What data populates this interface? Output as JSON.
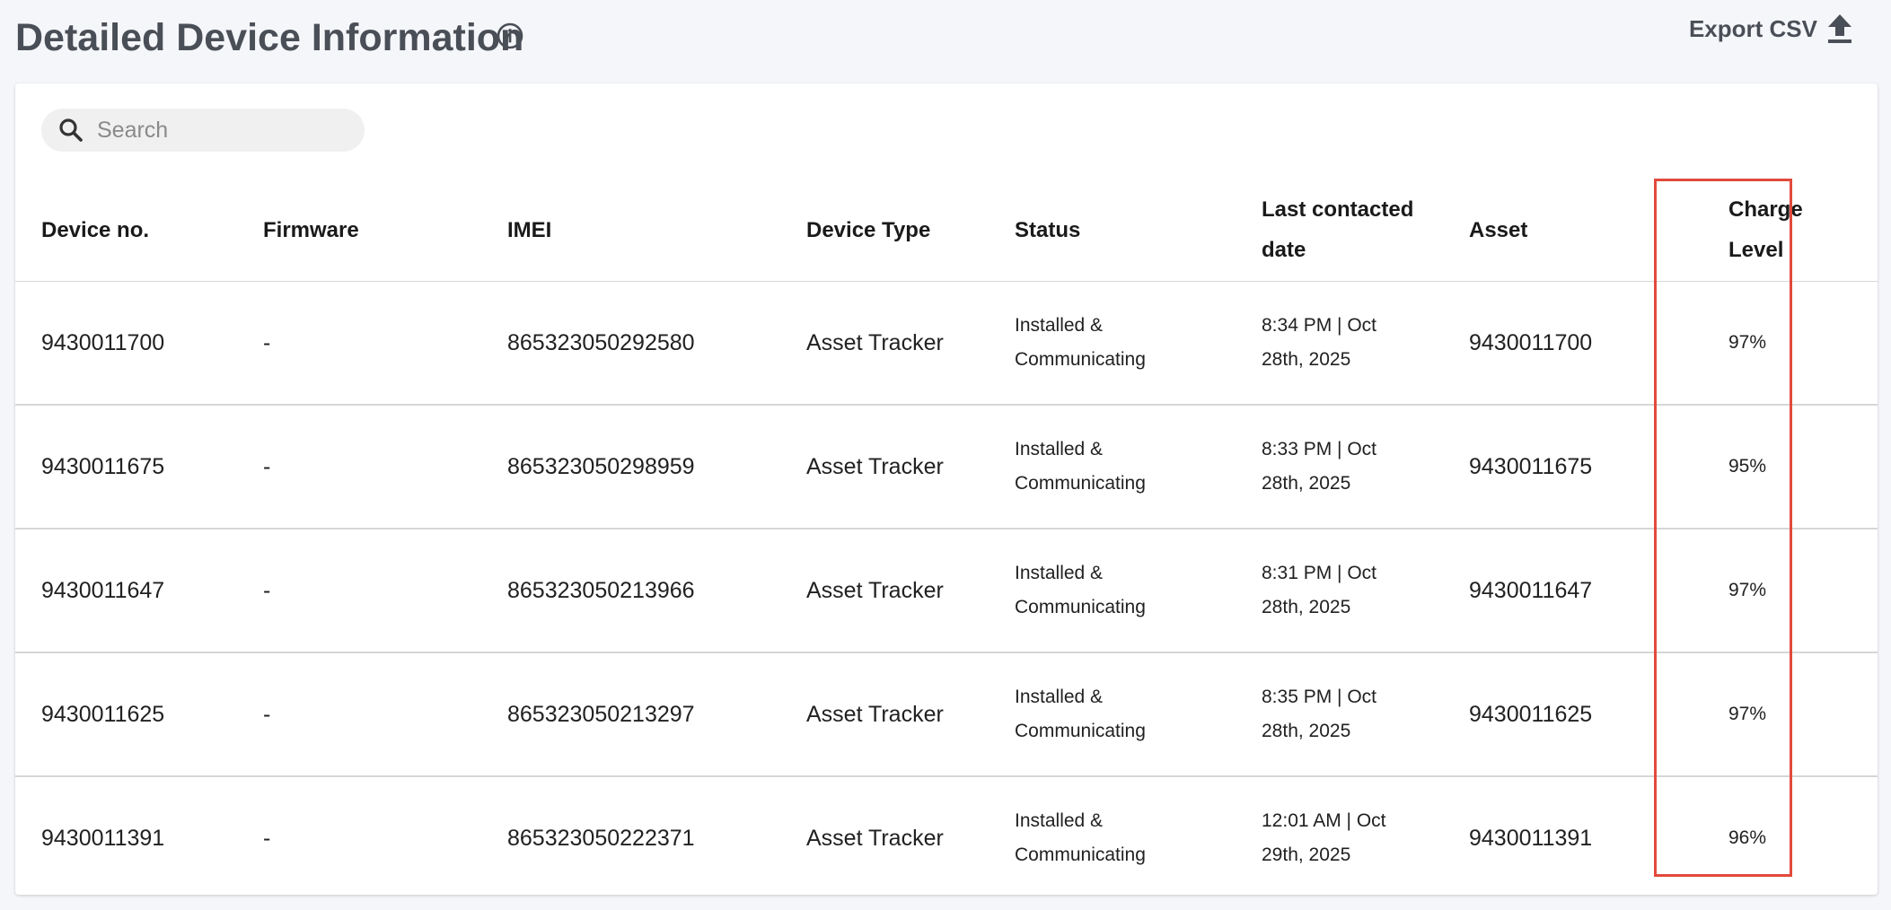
{
  "header": {
    "title": "Detailed Device Information",
    "export_label": "Export CSV"
  },
  "search": {
    "placeholder": "Search",
    "value": ""
  },
  "table": {
    "columns": [
      "Device no.",
      "Firmware",
      "IMEI",
      "Device Type",
      "Status",
      "Last contacted date",
      "Asset",
      "Charge Level"
    ],
    "rows": [
      {
        "device_no": "9430011700",
        "firmware": "-",
        "imei": "865323050292580",
        "device_type": "Asset Tracker",
        "status": "Installed & Communicating",
        "last_contacted": "8:34 PM | Oct 28th, 2025",
        "asset": "9430011700",
        "charge_level": "97%"
      },
      {
        "device_no": "9430011675",
        "firmware": "-",
        "imei": "865323050298959",
        "device_type": "Asset Tracker",
        "status": "Installed & Communicating",
        "last_contacted": "8:33 PM | Oct 28th, 2025",
        "asset": "9430011675",
        "charge_level": "95%"
      },
      {
        "device_no": "9430011647",
        "firmware": "-",
        "imei": "865323050213966",
        "device_type": "Asset Tracker",
        "status": "Installed & Communicating",
        "last_contacted": "8:31 PM | Oct 28th, 2025",
        "asset": "9430011647",
        "charge_level": "97%"
      },
      {
        "device_no": "9430011625",
        "firmware": "-",
        "imei": "865323050213297",
        "device_type": "Asset Tracker",
        "status": "Installed & Communicating",
        "last_contacted": "8:35 PM | Oct 28th, 2025",
        "asset": "9430011625",
        "charge_level": "97%"
      },
      {
        "device_no": "9430011391",
        "firmware": "-",
        "imei": "865323050222371",
        "device_type": "Asset Tracker",
        "status": "Installed & Communicating",
        "last_contacted": "12:01 AM | Oct 29th, 2025",
        "asset": "9430011391",
        "charge_level": "96%"
      }
    ]
  },
  "icons": {
    "info": "info-circle-icon",
    "export": "upload-icon",
    "search": "magnifier-icon"
  },
  "colors": {
    "background": "#f5f6fa",
    "title": "#4a4f57",
    "highlight_border": "#e24a3b"
  }
}
